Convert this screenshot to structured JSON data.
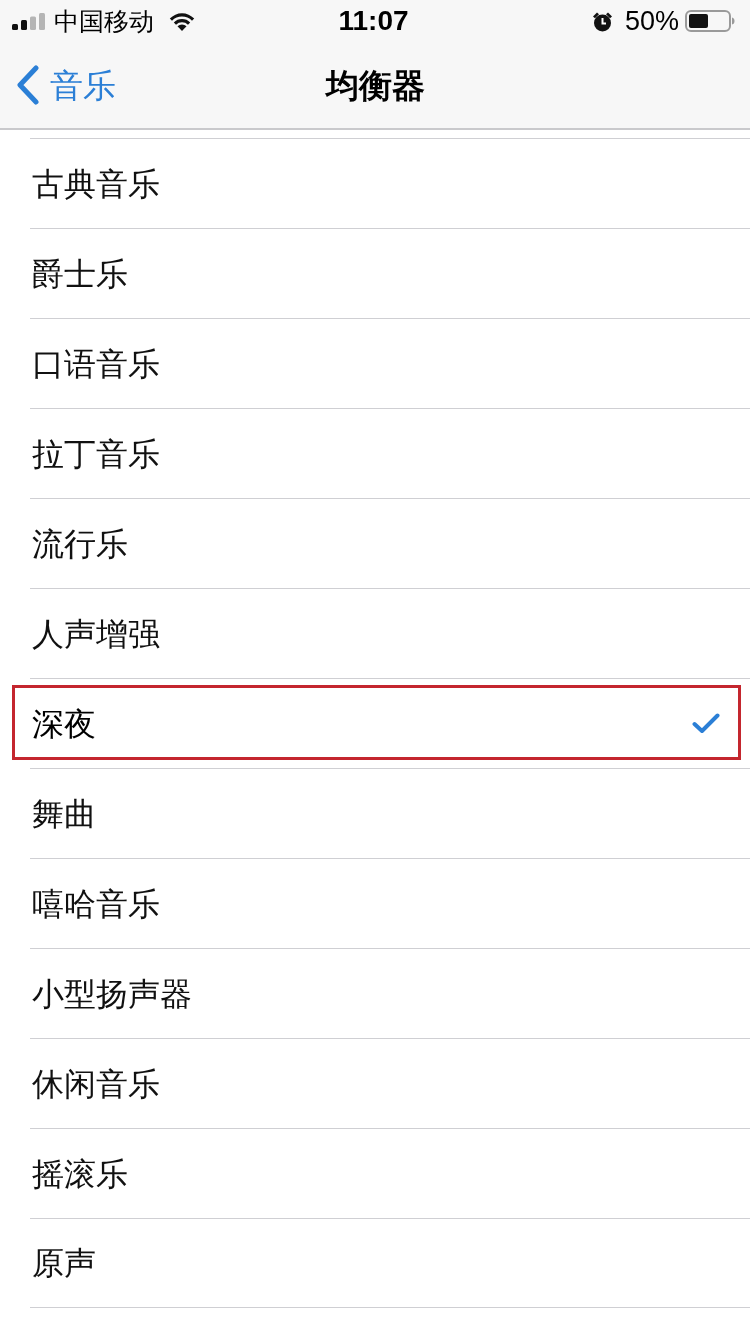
{
  "status_bar": {
    "carrier": "中国移动",
    "time": "11:07",
    "battery_percent": "50%"
  },
  "nav_bar": {
    "back_label": "音乐",
    "title": "均衡器"
  },
  "items": [
    {
      "label": "古典音乐",
      "selected": false,
      "highlighted": false
    },
    {
      "label": "爵士乐",
      "selected": false,
      "highlighted": false
    },
    {
      "label": "口语音乐",
      "selected": false,
      "highlighted": false
    },
    {
      "label": "拉丁音乐",
      "selected": false,
      "highlighted": false
    },
    {
      "label": "流行乐",
      "selected": false,
      "highlighted": false
    },
    {
      "label": "人声增强",
      "selected": false,
      "highlighted": false
    },
    {
      "label": "深夜",
      "selected": true,
      "highlighted": true
    },
    {
      "label": "舞曲",
      "selected": false,
      "highlighted": false
    },
    {
      "label": "嘻哈音乐",
      "selected": false,
      "highlighted": false
    },
    {
      "label": "小型扬声器",
      "selected": false,
      "highlighted": false
    },
    {
      "label": "休闲音乐",
      "selected": false,
      "highlighted": false
    },
    {
      "label": "摇滚乐",
      "selected": false,
      "highlighted": false
    },
    {
      "label": "原声",
      "selected": false,
      "highlighted": false
    }
  ]
}
